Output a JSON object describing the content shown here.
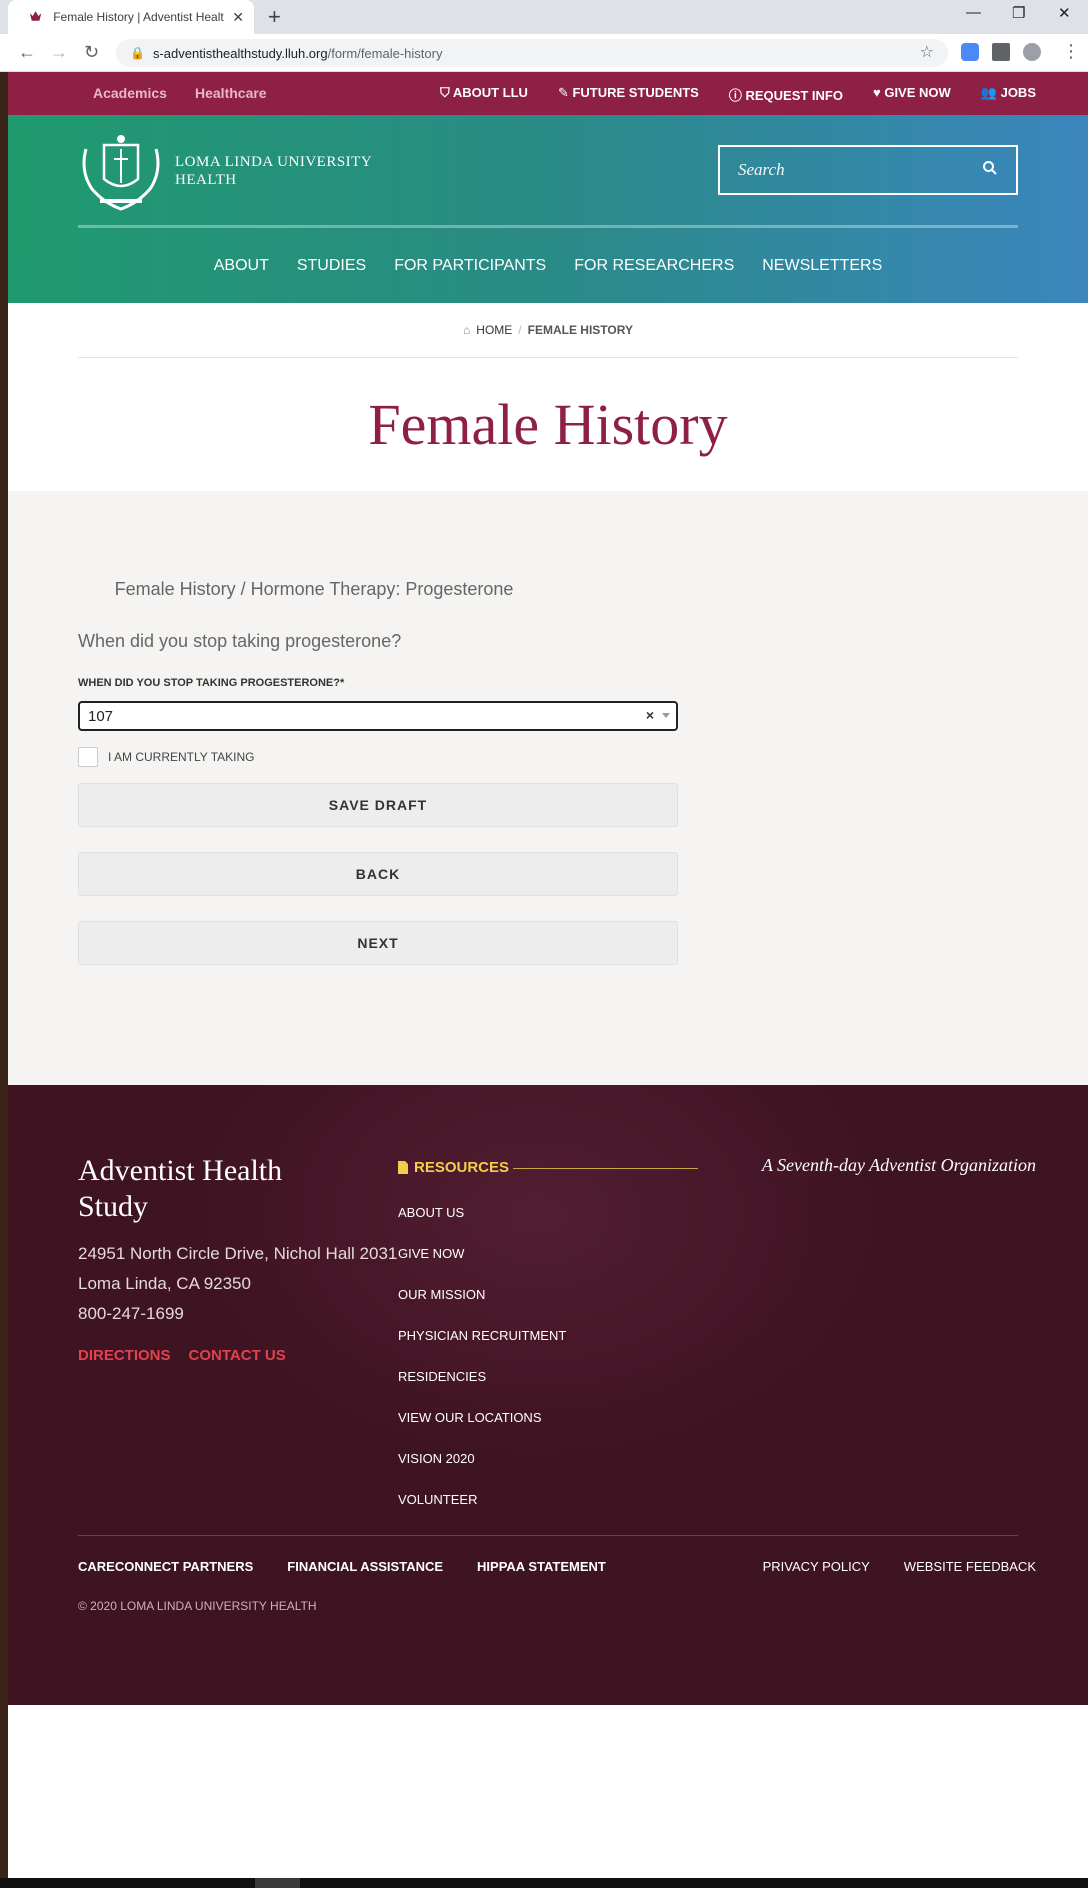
{
  "browser": {
    "tab_title": "Female History | Adventist Health Study",
    "url_host": "s-adventisthealthstudy.lluh.org",
    "url_path": "/form/female-history",
    "new_tab": "+",
    "tab_close": "✕",
    "win_min": "—",
    "win_restore": "❐",
    "win_close": "✕"
  },
  "topbar": {
    "left": [
      "Academics",
      "Healthcare"
    ],
    "right": [
      "ABOUT LLU",
      "FUTURE STUDENTS",
      "REQUEST INFO",
      "GIVE NOW",
      "JOBS"
    ]
  },
  "header": {
    "logo_line1": "LOMA LINDA UNIVERSITY",
    "logo_line2": "HEALTH",
    "search_placeholder": "Search",
    "nav": [
      "ABOUT",
      "STUDIES",
      "FOR PARTICIPANTS",
      "FOR RESEARCHERS",
      "NEWSLETTERS"
    ]
  },
  "breadcrumb": {
    "home": "HOME",
    "separator": "/",
    "current": "FEMALE HISTORY"
  },
  "page": {
    "title": "Female History"
  },
  "form": {
    "section_crumb": "Female History / Hormone Therapy: Progesterone",
    "question": "When did you stop taking progesterone?",
    "field_label": "WHEN DID YOU STOP TAKING PROGESTERONE?*",
    "select_value": "107",
    "clear_symbol": "×",
    "checkbox_label": "I AM CURRENTLY TAKING",
    "save_draft": "SAVE DRAFT",
    "back": "BACK",
    "next": "NEXT"
  },
  "footer": {
    "org_name": "Adventist Health Study",
    "address_line1": "24951 North Circle Drive, Nichol Hall 2031",
    "address_line2": "Loma Linda, CA 92350",
    "phone": "800-247-1699",
    "directions": "DIRECTIONS",
    "contact": "CONTACT US",
    "resources_heading": "RESOURCES",
    "resources": [
      "ABOUT US",
      "GIVE NOW",
      "OUR MISSION",
      "PHYSICIAN RECRUITMENT",
      "RESIDENCIES",
      "VIEW OUR LOCATIONS",
      "VISION 2020",
      "VOLUNTEER"
    ],
    "tagline": "A Seventh-day Adventist Organization",
    "bottom_left": [
      "CARECONNECT PARTNERS",
      "FINANCIAL ASSISTANCE",
      "HIPPAA STATEMENT"
    ],
    "bottom_right": [
      "PRIVACY POLICY",
      "WEBSITE FEEDBACK"
    ],
    "copyright": "© 2020 LOMA LINDA UNIVERSITY HEALTH"
  },
  "colors": {
    "brand_maroon": "#8e1f45",
    "footer_bg": "#3e1322",
    "accent_red": "#e0434f",
    "accent_gold": "#f2cf4a"
  }
}
